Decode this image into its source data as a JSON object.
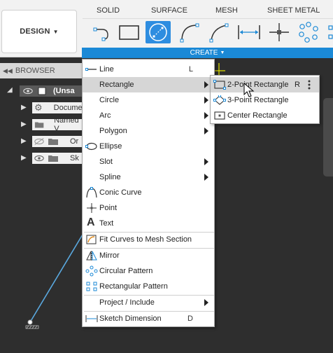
{
  "toolbar": {
    "design_label": "DESIGN",
    "tabs": [
      "SOLID",
      "SURFACE",
      "MESH",
      "SHEET METAL"
    ],
    "create_label": "CREATE"
  },
  "browser": {
    "title": "BROWSER",
    "root_label": "(Unsa",
    "items": [
      "Docume",
      "Named V",
      "Or",
      "Sk"
    ]
  },
  "create_menu": {
    "items": [
      {
        "label": "Line",
        "shortcut": "L"
      },
      {
        "label": "Rectangle"
      },
      {
        "label": "Circle"
      },
      {
        "label": "Arc"
      },
      {
        "label": "Polygon"
      },
      {
        "label": "Ellipse"
      },
      {
        "label": "Slot"
      },
      {
        "label": "Spline"
      },
      {
        "label": "Conic Curve"
      },
      {
        "label": "Point"
      },
      {
        "label": "Text"
      },
      {
        "label": "Fit Curves to Mesh Section"
      },
      {
        "label": "Mirror"
      },
      {
        "label": "Circular Pattern"
      },
      {
        "label": "Rectangular Pattern"
      },
      {
        "label": "Project / Include"
      },
      {
        "label": "Sketch Dimension",
        "shortcut": "D"
      }
    ]
  },
  "rectangle_submenu": {
    "items": [
      {
        "label": "2-Point Rectangle",
        "shortcut": "R"
      },
      {
        "label": "3-Point Rectangle"
      },
      {
        "label": "Center Rectangle"
      }
    ]
  },
  "colors": {
    "accent": "#1b89d6",
    "active_tool": "#2e8de0",
    "highlight": "#d6d6d6",
    "canvas": "#2e2e2e"
  }
}
